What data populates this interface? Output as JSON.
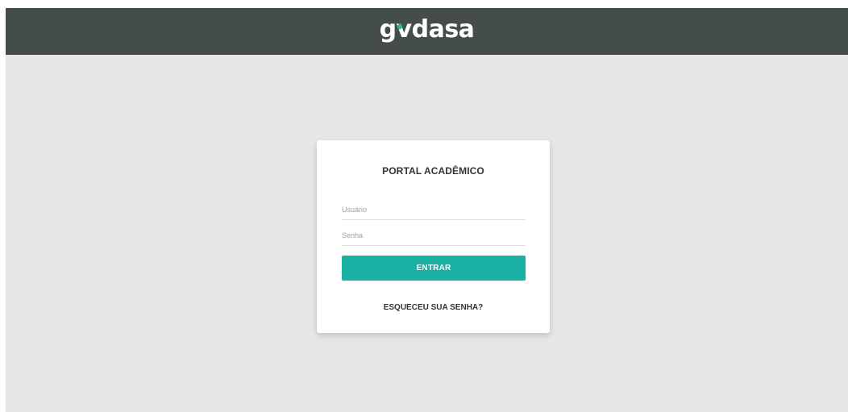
{
  "header": {
    "logo_text": "gvdasa",
    "logo_part_g": "g",
    "logo_part_v": "v",
    "logo_part_rest": "dasa",
    "background_color": "#454d4a",
    "logo_accent_color": "#20b2a0"
  },
  "login": {
    "title": "PORTAL ACADÊMICO",
    "username_placeholder": "Usuário",
    "username_value": "",
    "password_placeholder": "Senha",
    "password_value": "",
    "submit_label": "ENTRAR",
    "forgot_label": "ESQUECEU SUA SENHA?",
    "button_color": "#1ab1a4"
  },
  "page": {
    "background_color": "#e7e7e7"
  }
}
